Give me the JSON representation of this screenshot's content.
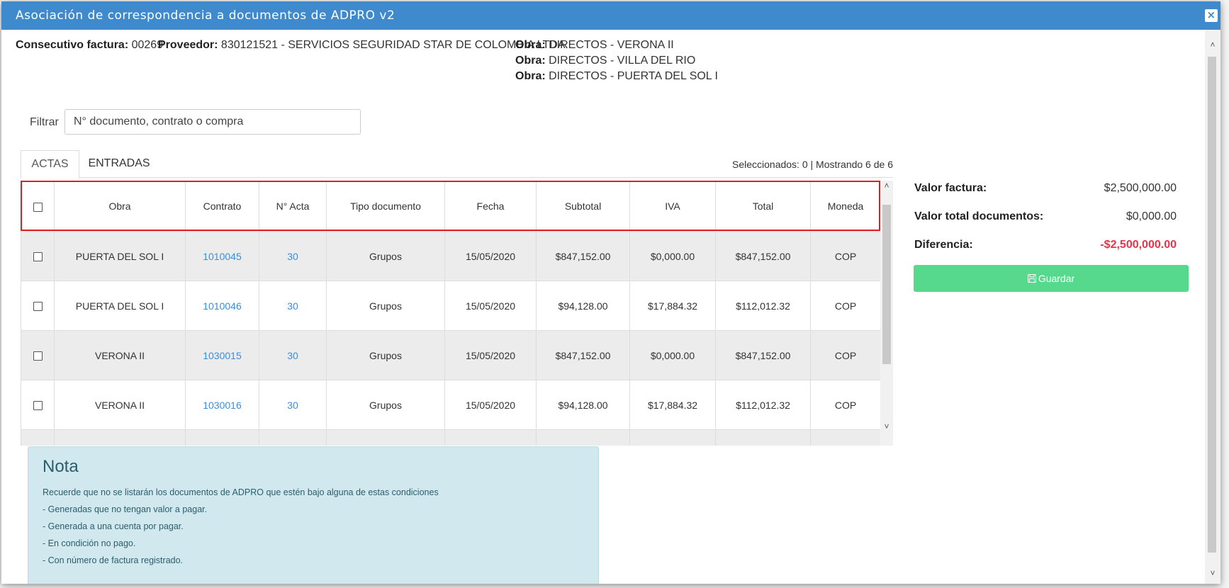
{
  "dialog": {
    "title": "Asociación de correspondencia a documentos de ADPRO v2",
    "close_icon": "close-icon"
  },
  "info": {
    "consecutivo_label": "Consecutivo factura:",
    "consecutivo_value": "00269",
    "proveedor_label": "Proveedor:",
    "proveedor_value": "830121521 - SERVICIOS SEGURIDAD STAR DE COLOMBIA LTDA",
    "obras": [
      {
        "label": "Obra:",
        "value": "DIRECTOS - VERONA II"
      },
      {
        "label": "Obra:",
        "value": "DIRECTOS - VILLA DEL RIO"
      },
      {
        "label": "Obra:",
        "value": "DIRECTOS - PUERTA DEL SOL I"
      }
    ]
  },
  "filter": {
    "label": "Filtrar",
    "placeholder": "N° documento, contrato o compra"
  },
  "tabs": [
    {
      "label": "ACTAS",
      "active": true
    },
    {
      "label": "ENTRADAS",
      "active": false
    }
  ],
  "selection_info": "Seleccionados: 0 | Mostrando 6 de 6",
  "table": {
    "headers": [
      "Obra",
      "Contrato",
      "N° Acta",
      "Tipo documento",
      "Fecha",
      "Subtotal",
      "IVA",
      "Total",
      "Moneda"
    ],
    "rows": [
      {
        "obra": "PUERTA DEL SOL I",
        "contrato": "1010045",
        "acta": "30",
        "tipo": "Grupos",
        "fecha": "15/05/2020",
        "subtotal": "$847,152.00",
        "iva": "$0,000.00",
        "total": "$847,152.00",
        "moneda": "COP"
      },
      {
        "obra": "PUERTA DEL SOL I",
        "contrato": "1010046",
        "acta": "30",
        "tipo": "Grupos",
        "fecha": "15/05/2020",
        "subtotal": "$94,128.00",
        "iva": "$17,884.32",
        "total": "$112,012.32",
        "moneda": "COP"
      },
      {
        "obra": "VERONA II",
        "contrato": "1030015",
        "acta": "30",
        "tipo": "Grupos",
        "fecha": "15/05/2020",
        "subtotal": "$847,152.00",
        "iva": "$0,000.00",
        "total": "$847,152.00",
        "moneda": "COP"
      },
      {
        "obra": "VERONA II",
        "contrato": "1030016",
        "acta": "30",
        "tipo": "Grupos",
        "fecha": "15/05/2020",
        "subtotal": "$94,128.00",
        "iva": "$17,884.32",
        "total": "$112,012.32",
        "moneda": "COP"
      }
    ]
  },
  "nota": {
    "title": "Nota",
    "lines": [
      "Recuerde que no se listarán los documentos de ADPRO que estén bajo alguna de estas condiciones",
      "- Generadas que no tengan valor a pagar.",
      "- Generada a una cuenta por pagar.",
      "- En condición no pago.",
      "- Con número de factura registrado."
    ]
  },
  "summary": {
    "valor_factura_label": "Valor factura:",
    "valor_factura": "$2,500,000.00",
    "valor_total_label": "Valor total documentos:",
    "valor_total": "$0,000.00",
    "diferencia_label": "Diferencia:",
    "diferencia": "-$2,500,000.00",
    "guardar_label": "Guardar",
    "guardar_icon": "floppy-disk-icon"
  },
  "colors": {
    "titlebar": "#3f8acd",
    "link": "#3c8dde",
    "save_button": "#56d98c",
    "negative": "#e8334a",
    "highlight_border": "#e11d26",
    "note_bg": "#d1e8ee"
  }
}
